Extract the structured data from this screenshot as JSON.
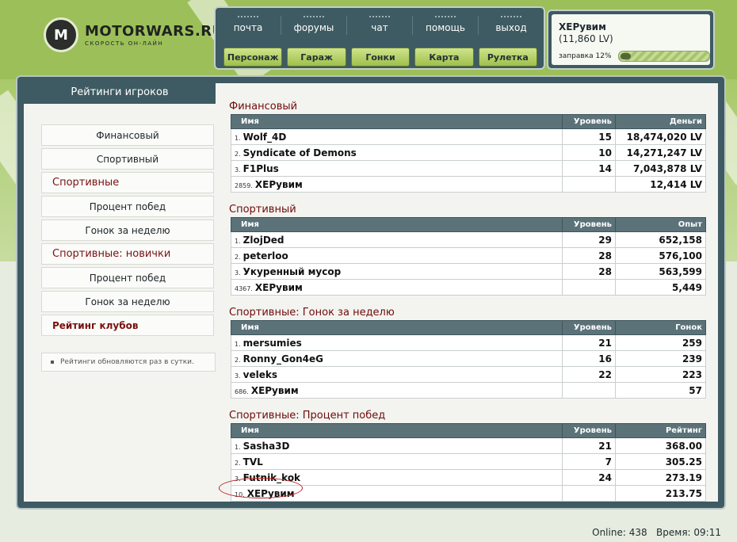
{
  "logo": {
    "icon_letters": "M",
    "title": "MOTORWARS.RU",
    "subtitle": "СКОРОСТЬ ОН-ЛАЙН"
  },
  "nav": {
    "links": [
      "почта",
      "форумы",
      "чат",
      "помощь",
      "выход"
    ],
    "buttons": [
      "Персонаж",
      "Гараж",
      "Гонки",
      "Карта",
      "Рулетка"
    ]
  },
  "user": {
    "name": "ХЕРувим",
    "money": "(11,860 LV)",
    "fuel_label": "заправка 12%",
    "fuel_fraction": 0.12
  },
  "sidebar": {
    "title": "Рейтинги игроков",
    "items": [
      {
        "label": "Финансовый",
        "kind": "sub"
      },
      {
        "label": "Спортивный",
        "kind": "sub"
      },
      {
        "label": "Спортивные",
        "kind": "head"
      },
      {
        "label": "Процент побед",
        "kind": "sub"
      },
      {
        "label": "Гонок за неделю",
        "kind": "sub"
      },
      {
        "label": "Спортивные: новички",
        "kind": "head"
      },
      {
        "label": "Процент побед",
        "kind": "sub"
      },
      {
        "label": "Гонок за неделю",
        "kind": "sub"
      },
      {
        "label": "Рейтинг клубов",
        "kind": "club"
      }
    ],
    "note": "Рейтинги обновляются раз в сутки."
  },
  "rankings": [
    {
      "title": "Финансовый",
      "headers": [
        "Имя",
        "Уровень",
        "Деньги"
      ],
      "rows": [
        {
          "rank": "1.",
          "name": "Wolf_4D",
          "level": "15",
          "value": "18,474,020 LV"
        },
        {
          "rank": "2.",
          "name": "Syndicate of Demons",
          "level": "10",
          "value": "14,271,247 LV"
        },
        {
          "rank": "3.",
          "name": "F1Plus",
          "level": "14",
          "value": "7,043,878 LV"
        },
        {
          "rank": "2859.",
          "name": "ХЕРувим",
          "level": "",
          "value": "12,414 LV"
        }
      ]
    },
    {
      "title": "Спортивный",
      "headers": [
        "Имя",
        "Уровень",
        "Опыт"
      ],
      "rows": [
        {
          "rank": "1.",
          "name": "ZlojDed",
          "level": "29",
          "value": "652,158"
        },
        {
          "rank": "2.",
          "name": "peterloo",
          "level": "28",
          "value": "576,100"
        },
        {
          "rank": "3.",
          "name": "Укуренный мусор",
          "level": "28",
          "value": "563,599"
        },
        {
          "rank": "4367.",
          "name": "ХЕРувим",
          "level": "",
          "value": "5,449"
        }
      ]
    },
    {
      "title": "Спортивные: Гонок за неделю",
      "headers": [
        "Имя",
        "Уровень",
        "Гонок"
      ],
      "rows": [
        {
          "rank": "1.",
          "name": "mersumies",
          "level": "21",
          "value": "259"
        },
        {
          "rank": "2.",
          "name": "Ronny_Gon4eG",
          "level": "16",
          "value": "239"
        },
        {
          "rank": "3.",
          "name": "veleks",
          "level": "22",
          "value": "223"
        },
        {
          "rank": "686.",
          "name": "ХЕРувим",
          "level": "",
          "value": "57"
        }
      ]
    },
    {
      "title": "Спортивные: Процент побед",
      "headers": [
        "Имя",
        "Уровень",
        "Рейтинг"
      ],
      "rows": [
        {
          "rank": "1.",
          "name": "Sasha3D",
          "level": "21",
          "value": "368.00"
        },
        {
          "rank": "2.",
          "name": "TVL",
          "level": "7",
          "value": "305.25"
        },
        {
          "rank": "3.",
          "name": "Futnik_kok",
          "level": "24",
          "value": "273.19"
        },
        {
          "rank": "10.",
          "name": "ХЕРувим",
          "level": "",
          "value": "213.75"
        }
      ]
    }
  ],
  "footer": {
    "online": "Online: 438",
    "time": "Время: 09:11"
  },
  "colors": {
    "accent_green": "#9fc04a",
    "panel": "#3e5a63",
    "section_title": "#6f0a0a"
  }
}
